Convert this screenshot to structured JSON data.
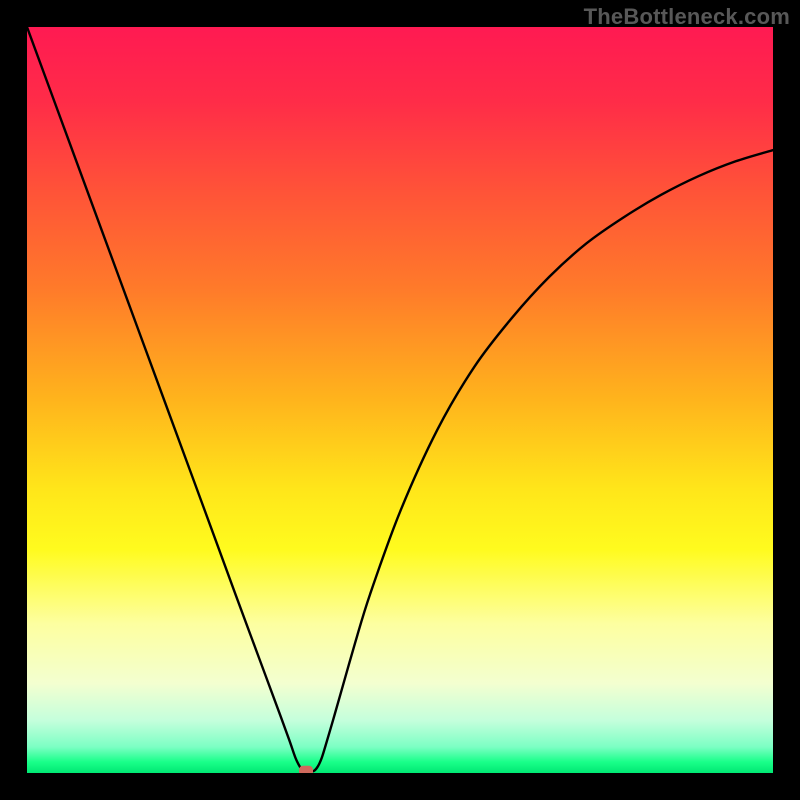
{
  "watermark": "TheBottleneck.com",
  "chart_data": {
    "type": "line",
    "title": "",
    "xlabel": "",
    "ylabel": "",
    "xlim": [
      0,
      100
    ],
    "ylim": [
      0,
      100
    ],
    "series": [
      {
        "name": "curve",
        "x": [
          0,
          5,
          10,
          15,
          20,
          25,
          28,
          30,
          32,
          34,
          35.2,
          36.0,
          36.6,
          37.0,
          37.2,
          37.5,
          38.0,
          38.5,
          39.0,
          39.5,
          40.0,
          41.0,
          42.0,
          44.0,
          46.0,
          50.0,
          55.0,
          60.0,
          65.0,
          70.0,
          75.0,
          80.0,
          85.0,
          90.0,
          95.0,
          100.0
        ],
        "y": [
          100,
          86.4,
          72.8,
          59.2,
          45.6,
          32.0,
          23.8,
          18.4,
          13.0,
          7.6,
          4.3,
          2.0,
          0.8,
          0.3,
          0.2,
          0.2,
          0.2,
          0.3,
          0.9,
          2.0,
          3.6,
          7.0,
          10.5,
          17.5,
          24.0,
          35.0,
          46.0,
          54.5,
          61.0,
          66.5,
          71.0,
          74.5,
          77.5,
          80.0,
          82.0,
          83.5
        ]
      }
    ],
    "marker": {
      "x": 37.4,
      "y": 0.3,
      "color": "#cf6a5d"
    },
    "gradient_stops": [
      {
        "offset": 0.0,
        "color": "#ff1a52"
      },
      {
        "offset": 0.1,
        "color": "#ff2c48"
      },
      {
        "offset": 0.22,
        "color": "#ff5338"
      },
      {
        "offset": 0.35,
        "color": "#ff7a2a"
      },
      {
        "offset": 0.5,
        "color": "#ffb41c"
      },
      {
        "offset": 0.62,
        "color": "#ffe61a"
      },
      {
        "offset": 0.7,
        "color": "#fffb1e"
      },
      {
        "offset": 0.8,
        "color": "#fdffa0"
      },
      {
        "offset": 0.88,
        "color": "#f3ffd0"
      },
      {
        "offset": 0.93,
        "color": "#c4ffdc"
      },
      {
        "offset": 0.965,
        "color": "#7cffc4"
      },
      {
        "offset": 0.985,
        "color": "#1aff8a"
      },
      {
        "offset": 1.0,
        "color": "#00e873"
      }
    ]
  }
}
